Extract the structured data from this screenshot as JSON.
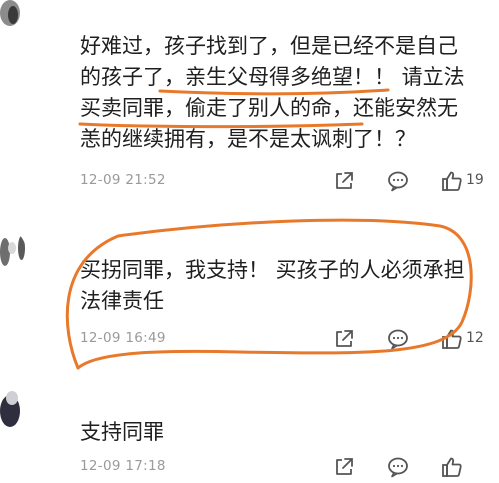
{
  "colors": {
    "annotation_orange": "#e9792a",
    "timestamp_gray": "#9a9a9a",
    "icon_gray": "#555555"
  },
  "comments": [
    {
      "lines": [
        "好难过，孩子找到了，但是已经不是自己",
        "的孩子了，亲生父母得多绝望！！ 请立法",
        "买卖同罪，偷走了别人的命，还能安然无",
        "恙的继续拥有，是不是太讽刺了！？"
      ],
      "timestamp": "12-09 21:52",
      "likes": "19",
      "icons": [
        "share-icon",
        "comment-icon",
        "thumbs-up-icon"
      ]
    },
    {
      "lines": [
        "买拐同罪，我支持！ 买孩子的人必须承担",
        "法律责任"
      ],
      "timestamp": "12-09 16:49",
      "likes": "12",
      "icons": [
        "share-icon",
        "comment-icon",
        "thumbs-up-icon"
      ]
    },
    {
      "lines": [
        "支持同罪"
      ],
      "timestamp": "12-09 17:18",
      "likes": "",
      "icons": [
        "share-icon",
        "comment-icon",
        "thumbs-up-icon"
      ]
    }
  ]
}
